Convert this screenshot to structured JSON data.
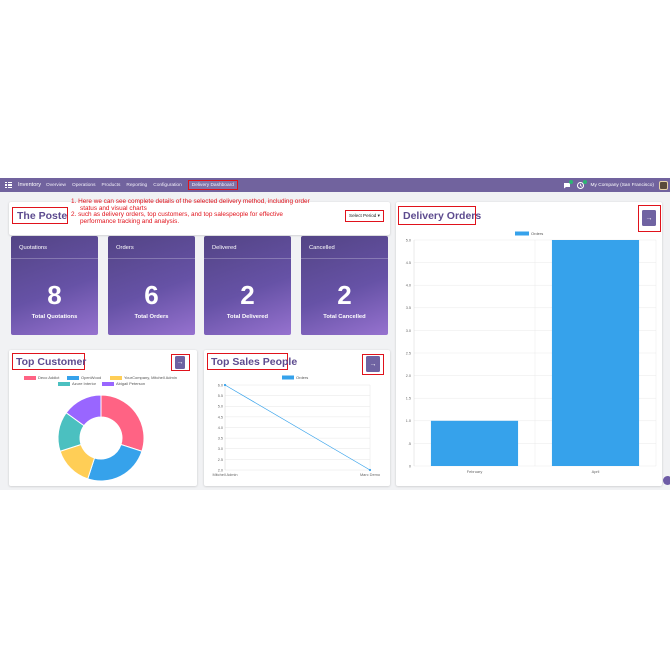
{
  "navbar": {
    "brand": "Inventory",
    "items": [
      "Overview",
      "Operations",
      "Products",
      "Reporting",
      "Configuration"
    ],
    "active_item": "Delivery Dashboard",
    "company": "My Company (San Francisco)",
    "icons": [
      "apps-grid-icon",
      "chat-icon",
      "activity-clock-icon",
      "avatar"
    ]
  },
  "poste": {
    "title": "The Poste",
    "annotation": [
      "1. Here we can see complete details of the selected delivery method, including order",
      "status and visual charts",
      "2. such as delivery orders, top customers, and top salespeople for effective",
      "performance tracking and analysis."
    ],
    "select_period": "Select Period ▾"
  },
  "kpis": [
    {
      "label": "Quotations",
      "value": "8",
      "sub": "Total Quotations"
    },
    {
      "label": "Orders",
      "value": "6",
      "sub": "Total Orders"
    },
    {
      "label": "Delivered",
      "value": "2",
      "sub": "Total Delivered"
    },
    {
      "label": "Cancelled",
      "value": "2",
      "sub": "Total Cancelled"
    }
  ],
  "top_customer": {
    "title": "Top Customer",
    "arrow": "→"
  },
  "top_sales": {
    "title": "Top Sales People",
    "arrow": "→"
  },
  "delivery_orders": {
    "title": "Delivery Orders",
    "arrow": "→"
  },
  "colors": {
    "primary": "#71639e",
    "highlight": "#e0121b",
    "bar": "#36a2eb"
  },
  "chart_data": [
    {
      "type": "pie",
      "legend_placement": "top",
      "categories": [
        "Deco Addict",
        "OpenWood",
        "YourCompany, Mitchell Admin",
        "Azure Interior",
        "Abigail Peterson"
      ],
      "values": [
        30,
        25,
        15,
        15,
        15
      ],
      "colors": [
        "#ff6384",
        "#36a2eb",
        "#ffce56",
        "#4bc0c0",
        "#9966ff"
      ],
      "donut": true
    },
    {
      "type": "line",
      "legend_placement": "top",
      "categories": [
        "Mitchell Admin",
        "Marc Demo"
      ],
      "series": [
        {
          "name": "Orders",
          "values": [
            6,
            2
          ]
        }
      ],
      "ylim": [
        2,
        6
      ],
      "yticks": [
        "6.0",
        "5.5",
        "5.0",
        "4.5",
        "4.0",
        "3.5",
        "3.0",
        "2.5",
        "2.0"
      ],
      "grid": true,
      "color": "#36a2eb"
    },
    {
      "type": "bar",
      "legend_placement": "top",
      "categories": [
        "February",
        "April"
      ],
      "series": [
        {
          "name": "Orders",
          "values": [
            1,
            5
          ]
        }
      ],
      "ylim": [
        0,
        5
      ],
      "yticks": [
        "5.0",
        "4.5",
        "4.0",
        "3.5",
        "3.0",
        "2.5",
        "2.0",
        "1.5",
        "1.0",
        ".5",
        "0"
      ],
      "grid": true,
      "color": "#36a2eb"
    }
  ]
}
